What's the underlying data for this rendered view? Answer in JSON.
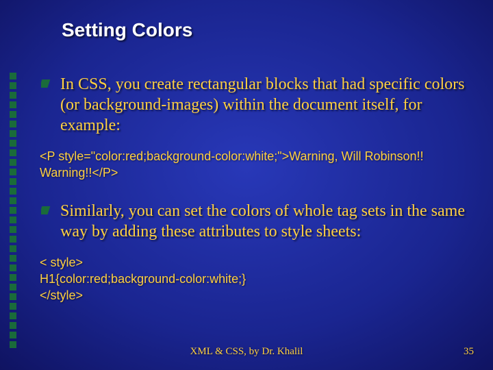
{
  "title": "Setting Colors",
  "bullets": [
    {
      "text": "In CSS, you create rectangular blocks that had specific colors (or background-images) within the document itself, for example:"
    },
    {
      "text": "Similarly, you can set the colors of whole tag sets in the same way by adding these attributes to style sheets:"
    }
  ],
  "code_blocks": [
    "<P style=\"color:red;background-color:white;\">Warning, Will Robinson!! Warning!!</P>",
    "< style>\nH1{color:red;background-color:white;}\n</style>"
  ],
  "footer": "XML & CSS, by Dr. Khalil",
  "page_number": "35",
  "decor_count": 29
}
